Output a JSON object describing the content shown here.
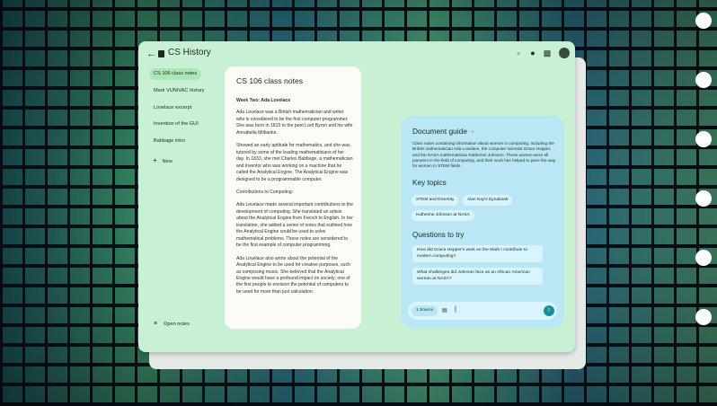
{
  "app": {
    "back_icon": "arrow-left-icon",
    "title": "CS History"
  },
  "toolbar_icons": [
    "chat-icon",
    "bug-icon",
    "comments-icon",
    "avatar"
  ],
  "sidebar": {
    "items": [
      {
        "label": "CS 106 class notes",
        "active": true
      },
      {
        "label": "Mark VUNIVAC history",
        "active": false
      },
      {
        "label": "Lovelace excerpt",
        "active": false
      },
      {
        "label": "Invention of the GUI",
        "active": false
      },
      {
        "label": "Babbage intro",
        "active": false
      }
    ],
    "new_label": "New",
    "open_notes_label": "Open notes"
  },
  "document": {
    "title": "CS 106 class notes",
    "heading": "Week Two: Ada Lovelace",
    "paragraphs": [
      "Ada Lovelace was a British mathematician and writer who is considered to be the first computer programmer. She was born in 1815 to the poet Lord Byron and his wife Annabella Milbanke.",
      "Showed an early aptitude for mathematics, and she was tutored by some of the leading mathematicians of her day. In 1833, she met Charles Babbage, a mathematician and inventor who was working on a machine that he called the Analytical Engine. The Analytical Engine was designed to be a programmable computer.",
      "Contributions to Computing:",
      "Ada Lovelace made several important contributions to the development of computing. She translated an article about the Analytical Engine from French to English. In her translation, she added a series of notes that outlined how the Analytical Engine could be used to solve mathematical problems. These notes are considered to be the first example of computer programming.",
      "Ada Lovelace also wrote about the potential of the Analytical Engine to be used for creative purposes, such as composing music. She believed that the Analytical Engine would have a profound impact on society; one of the first people to envision the potential of computers to be used for more than just calculation."
    ]
  },
  "guide": {
    "title": "Document guide",
    "description": "Class notes containing information about women in computing, including the British mathematician Ada Lovelace, the computer scientist Grace Hopper, and the NASA mathematician Katherine Johnson. These women were all pioneers in the field of computing, and their work has helped to pave the way for women in STEM fields.",
    "key_topics_heading": "Key topics",
    "topics": [
      "STEM and Diversity",
      "Alan Kay's Dynabook",
      "Katherine Johnson at NASA"
    ],
    "questions_heading": "Questions to try",
    "questions": [
      "How did Grace Hopper's work on the Mark I contribute to modern computing?",
      "What challenges did Johnson face as an African American woman at NASA?"
    ],
    "source_label": "1 Source",
    "input_value": "|",
    "send_icon": "arrow-up-icon"
  }
}
